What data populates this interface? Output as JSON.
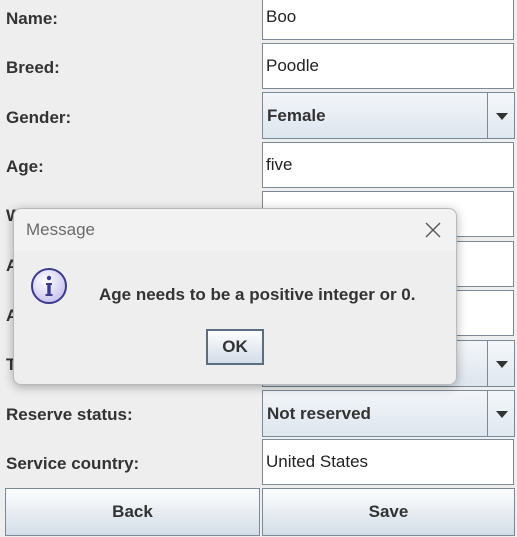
{
  "form": {
    "name_label": "Name:",
    "name_value": "Boo",
    "breed_label": "Breed:",
    "breed_value": "Poodle",
    "gender_label": "Gender:",
    "gender_value": "Female",
    "age_label": "Age:",
    "age_value": "five",
    "weight_label_partial": "W",
    "row5_label_partial": "A",
    "row6_label_partial": "A",
    "row7_label_partial": "T",
    "reserve_label": "Reserve status:",
    "reserve_value": "Not reserved",
    "service_label": "Service country:",
    "service_value": "United States"
  },
  "buttons": {
    "back": "Back",
    "save": "Save"
  },
  "dialog": {
    "title": "Message",
    "message": "Age needs to be a positive integer or 0.",
    "ok": "OK"
  },
  "icons": {
    "dialog_close": "close-icon",
    "dialog_info": "info-icon",
    "combo_arrow": "chevron-down-icon"
  },
  "colors": {
    "info_icon_fill": "#c8c3f0",
    "info_icon_border": "#3b3a8c",
    "field_border": "#7a8a99"
  }
}
